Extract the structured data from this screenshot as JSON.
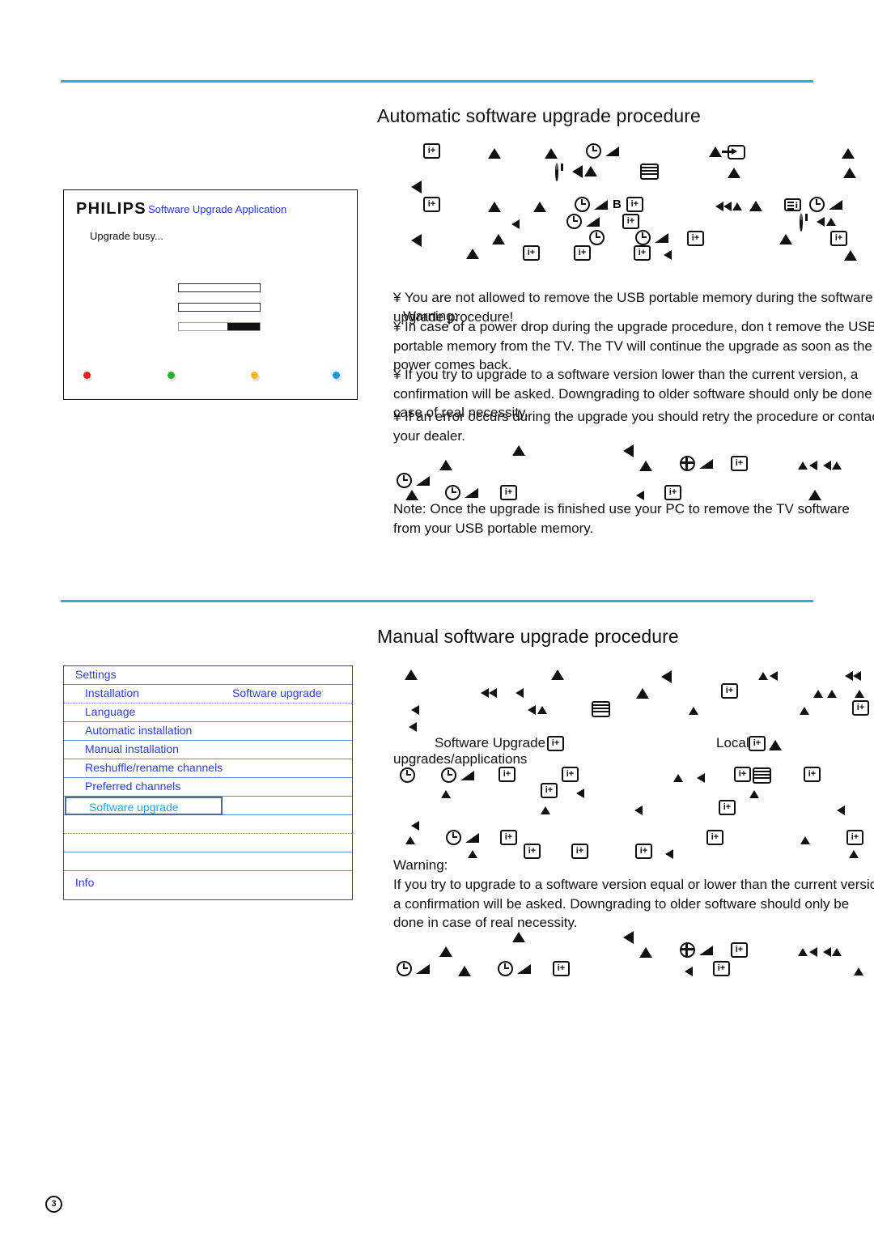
{
  "page": {
    "number": "3"
  },
  "sections": {
    "automatic": {
      "heading": "Automatic software upgrade procedure",
      "warning_label": "Warning:",
      "bullets": [
        "You are not allowed to remove the USB portable memory during the software upgrade procedure!",
        "In case of a power drop during the upgrade procedure, don t remove the USB portable memory from the TV. The TV will continue the upgrade as soon as the power comes back.",
        "If you try to upgrade to a software version lower than the current version, a confirmation will be asked. Downgrading to older software should only be done case of real necessity.",
        "If an error occurs during the upgrade you should retry the procedure or contac your dealer."
      ],
      "bullet_marker": "¥",
      "note": "Note: Once the upgrade is finished use your PC to remove the TV software from your USB portable memory."
    },
    "manual": {
      "heading": "Manual software upgrade procedure",
      "inline_labels": {
        "software_upgrade": "Software Upgrade",
        "upgrades_applications": "upgrades/applications",
        "local": "Local"
      },
      "warning_label": "Warning:",
      "warning_text": "If you try to upgrade to a software version equal or lower than the current versio a confirmation will be asked. Downgrading to older software should only be done in case of real necessity."
    }
  },
  "dialog": {
    "brand": "PHILIPS",
    "title": "Software Upgrade Application",
    "status": "Upgrade busy...",
    "progress_percent": 40,
    "dots": [
      {
        "name": "red",
        "color": "#e8201b"
      },
      {
        "name": "green",
        "color": "#22b52a"
      },
      {
        "name": "yellow",
        "color": "#f5b81c"
      },
      {
        "name": "blue",
        "color": "#0f9ae8"
      }
    ]
  },
  "settings_menu": {
    "title": "Settings",
    "submenu_label": "Installation",
    "right_column_label": "Software upgrade",
    "items": [
      "Language",
      "Automatic installation",
      "Manual installation",
      "Reshuffle/rename channels",
      "Preferred channels"
    ],
    "selected_item": "Software upgrade",
    "footer_item": "Info"
  },
  "colors": {
    "rule_blue": "#29a8ee",
    "menu_blue": "#2b3fd0",
    "selected_blue": "#29a3e8",
    "dialog_title_blue": "#2b38d8"
  },
  "glyph_runs": {
    "auto_1": [
      "iplus",
      "tri-up",
      "tri-up",
      "clock",
      "wedge",
      "arrow-box-combo",
      "tri-up"
    ],
    "auto_2": [
      "power",
      "tri-left",
      "tri-up",
      "menu",
      "tri-up",
      "tri-up"
    ],
    "auto_3": [
      "tri-left"
    ],
    "auto_4": [
      "iplus",
      "tri-up",
      "tri-up",
      "clock",
      "wedge",
      "B",
      "iplus",
      "tri-left-s",
      "tri-up",
      "menu-i",
      "clock",
      "wedge"
    ],
    "note_1": [
      "tri-up",
      "tri-left",
      "tri-up",
      "plus-circ",
      "wedge",
      "iplus",
      "tri-up",
      "tri-left"
    ],
    "manual_1": [
      "tri-up",
      "tri-up",
      "tri-left",
      "tri-up",
      "tri-left",
      "iplus",
      "tri-up",
      "tri-left"
    ]
  }
}
